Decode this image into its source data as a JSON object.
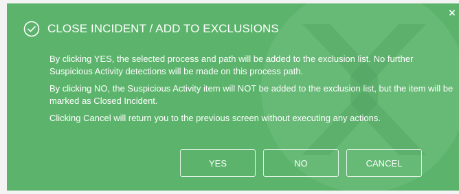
{
  "dialog": {
    "title": "CLOSE INCIDENT / ADD TO EXCLUSIONS",
    "close_label": "×",
    "paragraphs": [
      "By clicking YES, the selected process and path will be added to the exclusion list. No further Suspicious Activity detections will be made on this process path.",
      "By clicking NO, the Suspicious Activity item will NOT be added to the exclusion list, but the item will be marked as Closed Incident.",
      "Clicking Cancel will return you to the previous screen without executing any actions."
    ],
    "buttons": {
      "yes": "YES",
      "no": "NO",
      "cancel": "CANCEL"
    },
    "icons": {
      "header": "check-circle-icon",
      "close": "close-icon"
    },
    "colors": {
      "background": "#5cb46c",
      "text": "#ffffff"
    }
  }
}
